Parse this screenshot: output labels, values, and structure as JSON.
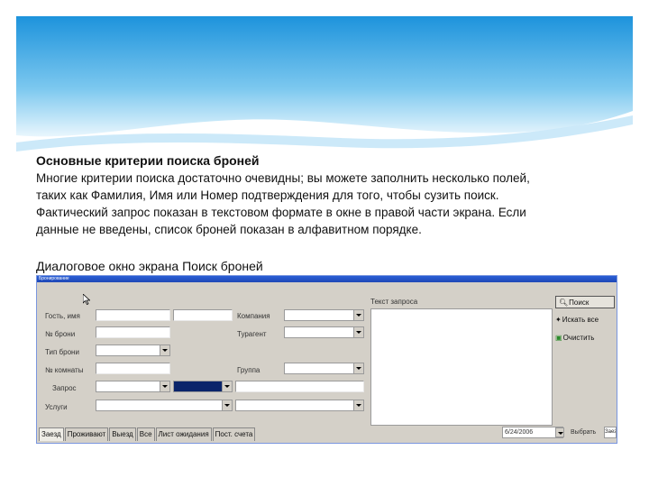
{
  "slide": {
    "title": "Основные критерии поиска броней",
    "paragraph_lines": [
      "Многие критерии поиска достаточно очевидны; вы можете заполнить несколько полей,",
      "таких как Фамилия, Имя или Номер подтверждения для того, чтобы сузить поиск.",
      "Фактический запрос показан в текстовом формате в окне в правой части экрана. Если",
      "данные не введены, список броней показан в алфавитном порядке."
    ],
    "caption": "Диалоговое окно экрана Поиск броней"
  },
  "window": {
    "title": "Бронирование",
    "fields": {
      "guest_label": "Гость, имя",
      "booking_no_label": "№ брони",
      "booking_type_label": "Тип брони",
      "room_no_label": "№ комнаты",
      "query_label": "Запрос",
      "services_label": "Услуги",
      "company_label": "Компания",
      "tour_agent_label": "Турагент",
      "group_label": "Группа"
    },
    "query_text_label": "Текст запроса",
    "buttons": {
      "search": "Поиск",
      "search_all": "Искать все",
      "clear": "Очистить"
    },
    "tabs": [
      "Заезд",
      "Проживают",
      "Выезд",
      "Все",
      "Лист ожидания",
      "Пост. счета"
    ],
    "date_value": "6/24/2006",
    "select_label": "Выбрать",
    "select_value": "Заезд"
  },
  "colors": {
    "window_bg": "#d4d0c8",
    "titlebar": "#2a5fd6",
    "header_blue": "#2b9fe0"
  }
}
